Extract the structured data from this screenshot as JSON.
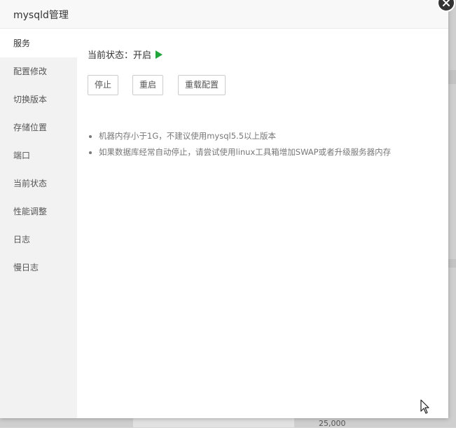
{
  "dialog": {
    "title": "mysqld管理"
  },
  "sidebar": {
    "items": [
      {
        "label": "服务",
        "active": true
      },
      {
        "label": "配置修改"
      },
      {
        "label": "切换版本"
      },
      {
        "label": "存储位置"
      },
      {
        "label": "端口"
      },
      {
        "label": "当前状态"
      },
      {
        "label": "性能调整"
      },
      {
        "label": "日志"
      },
      {
        "label": "慢日志"
      }
    ]
  },
  "service": {
    "status_label": "当前状态：开启",
    "status_icon": "play-icon",
    "status_color": "#20a53a",
    "buttons": {
      "stop": "停止",
      "restart": "重启",
      "reload": "重载配置"
    },
    "notes": [
      "机器内存小于1G，不建议使用mysql5.5以上版本",
      "如果数据库经常自动停止，请尝试使用linux工具箱增加SWAP或者升级服务器内存"
    ]
  },
  "background": {
    "footer_value": "25,000"
  }
}
